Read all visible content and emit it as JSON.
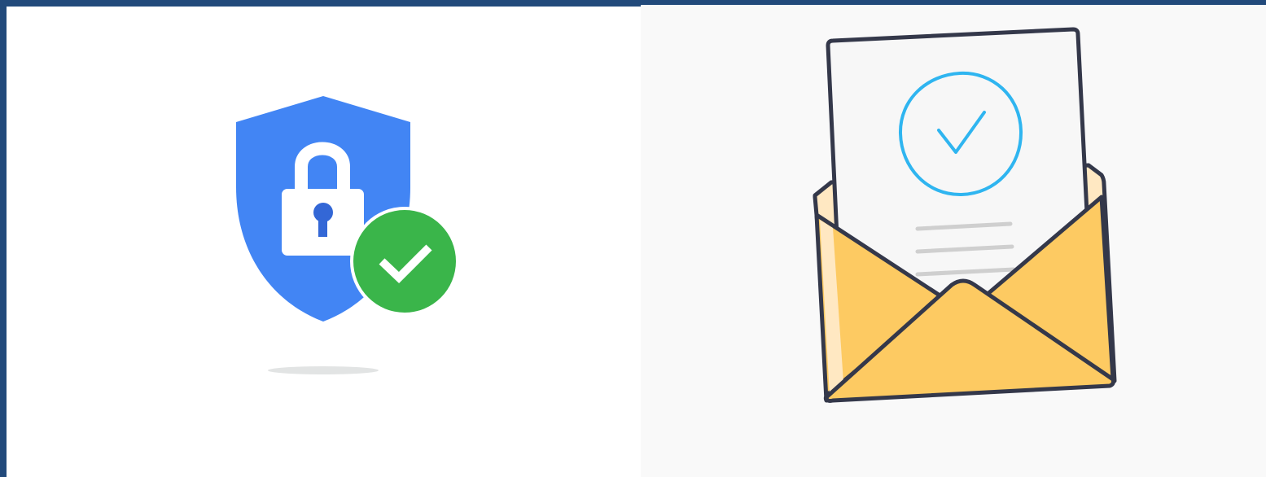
{
  "colors": {
    "frame": "#224a7b",
    "left_bg": "#ffffff",
    "right_bg": "#f9f9f9",
    "shield_blue": "#4285f4",
    "lock_white": "#ffffff",
    "keyhole_blue": "#3367d6",
    "badge_green": "#3ab54a",
    "shadow_grey": "#e2e4e4",
    "paper": "#f7f7f7",
    "check_circle": "#2fb5f0",
    "text_lines": "#cfcfcf",
    "envelope_yellow": "#fdca62",
    "envelope_light": "#ffe8c2",
    "outline": "#34384a"
  },
  "icons": {
    "left": "shield-lock-check-icon",
    "right": "open-envelope-check-icon"
  }
}
